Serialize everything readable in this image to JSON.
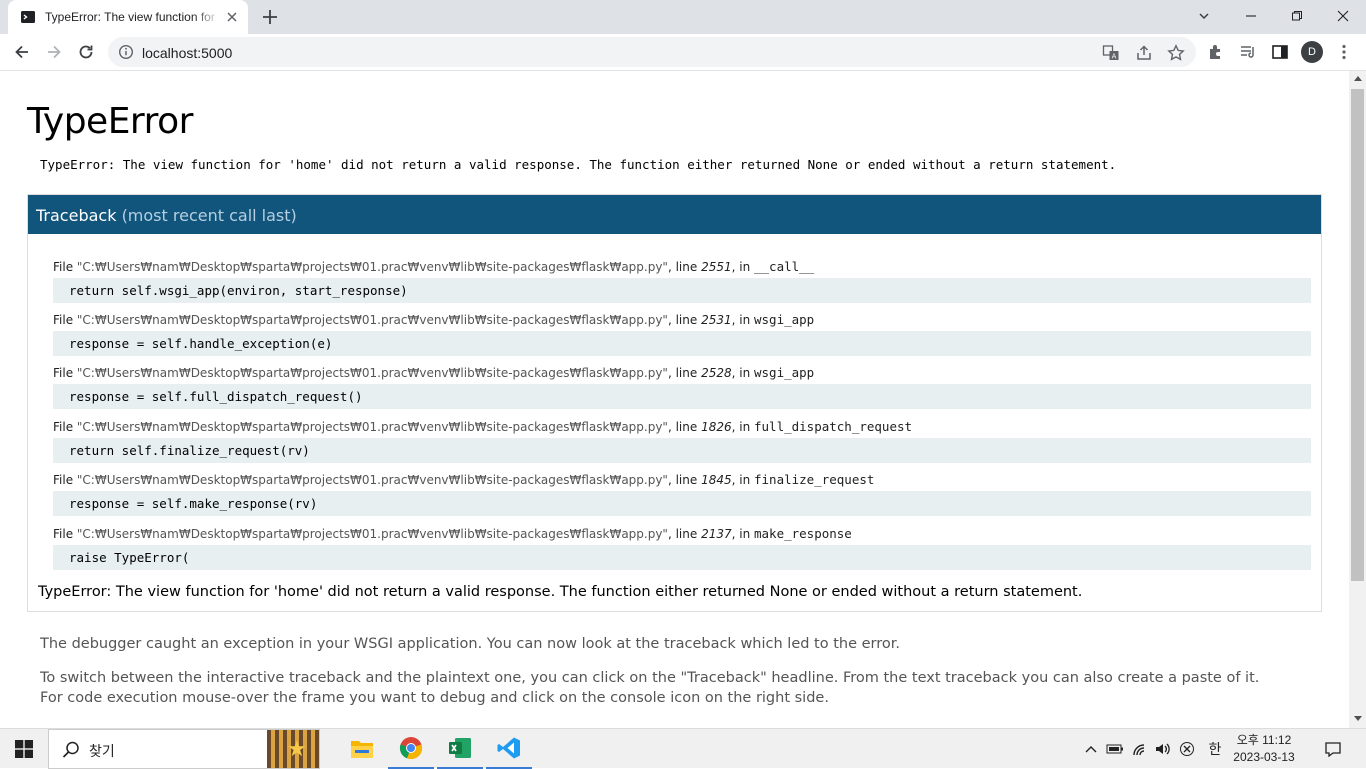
{
  "browser": {
    "tab_title": "TypeError: The view function for 'home' did not return a valid response",
    "url": "localhost:5000",
    "profile_initial": "D"
  },
  "page": {
    "title": "TypeError",
    "message": "TypeError: The view function for 'home' did not return a valid response. The function either returned None or ended without a return statement.",
    "traceback_label": "Traceback",
    "traceback_sub": "(most recent call last)",
    "frames": [
      {
        "file_prefix": "File ",
        "filename": "\"C:₩Users₩nam₩Desktop₩sparta₩projects₩01.prac₩venv₩lib₩site-packages₩flask₩app.py\"",
        "line_label": ", line ",
        "lineno": "2551",
        "in_label": ", in ",
        "func": "__call__",
        "code": "return self.wsgi_app(environ, start_response)"
      },
      {
        "file_prefix": "File ",
        "filename": "\"C:₩Users₩nam₩Desktop₩sparta₩projects₩01.prac₩venv₩lib₩site-packages₩flask₩app.py\"",
        "line_label": ", line ",
        "lineno": "2531",
        "in_label": ", in ",
        "func": "wsgi_app",
        "code": "response = self.handle_exception(e)"
      },
      {
        "file_prefix": "File ",
        "filename": "\"C:₩Users₩nam₩Desktop₩sparta₩projects₩01.prac₩venv₩lib₩site-packages₩flask₩app.py\"",
        "line_label": ", line ",
        "lineno": "2528",
        "in_label": ", in ",
        "func": "wsgi_app",
        "code": "response = self.full_dispatch_request()"
      },
      {
        "file_prefix": "File ",
        "filename": "\"C:₩Users₩nam₩Desktop₩sparta₩projects₩01.prac₩venv₩lib₩site-packages₩flask₩app.py\"",
        "line_label": ", line ",
        "lineno": "1826",
        "in_label": ", in ",
        "func": "full_dispatch_request",
        "code": "return self.finalize_request(rv)"
      },
      {
        "file_prefix": "File ",
        "filename": "\"C:₩Users₩nam₩Desktop₩sparta₩projects₩01.prac₩venv₩lib₩site-packages₩flask₩app.py\"",
        "line_label": ", line ",
        "lineno": "1845",
        "in_label": ", in ",
        "func": "finalize_request",
        "code": "response = self.make_response(rv)"
      },
      {
        "file_prefix": "File ",
        "filename": "\"C:₩Users₩nam₩Desktop₩sparta₩projects₩01.prac₩venv₩lib₩site-packages₩flask₩app.py\"",
        "line_label": ", line ",
        "lineno": "2137",
        "in_label": ", in ",
        "func": "make_response",
        "code": "raise TypeError("
      }
    ],
    "final_message": "TypeError: The view function for 'home' did not return a valid response. The function either returned None or ended without a return statement.",
    "explain_1": "The debugger caught an exception in your WSGI application. You can now look at the traceback which led to the error.",
    "explain_2": "To switch between the interactive traceback and the plaintext one, you can click on the \"Traceback\" headline. From the text traceback you can also create a paste of it. For code execution mouse-over the frame you want to debug and click on the console icon on the right side."
  },
  "taskbar": {
    "search_placeholder": "찾기",
    "ime": "한",
    "clock_ampm_time": "오후 11:12",
    "clock_date": "2023-03-13"
  },
  "colors": {
    "traceback_header": "#11557c",
    "code_bg": "#e8eff0"
  }
}
